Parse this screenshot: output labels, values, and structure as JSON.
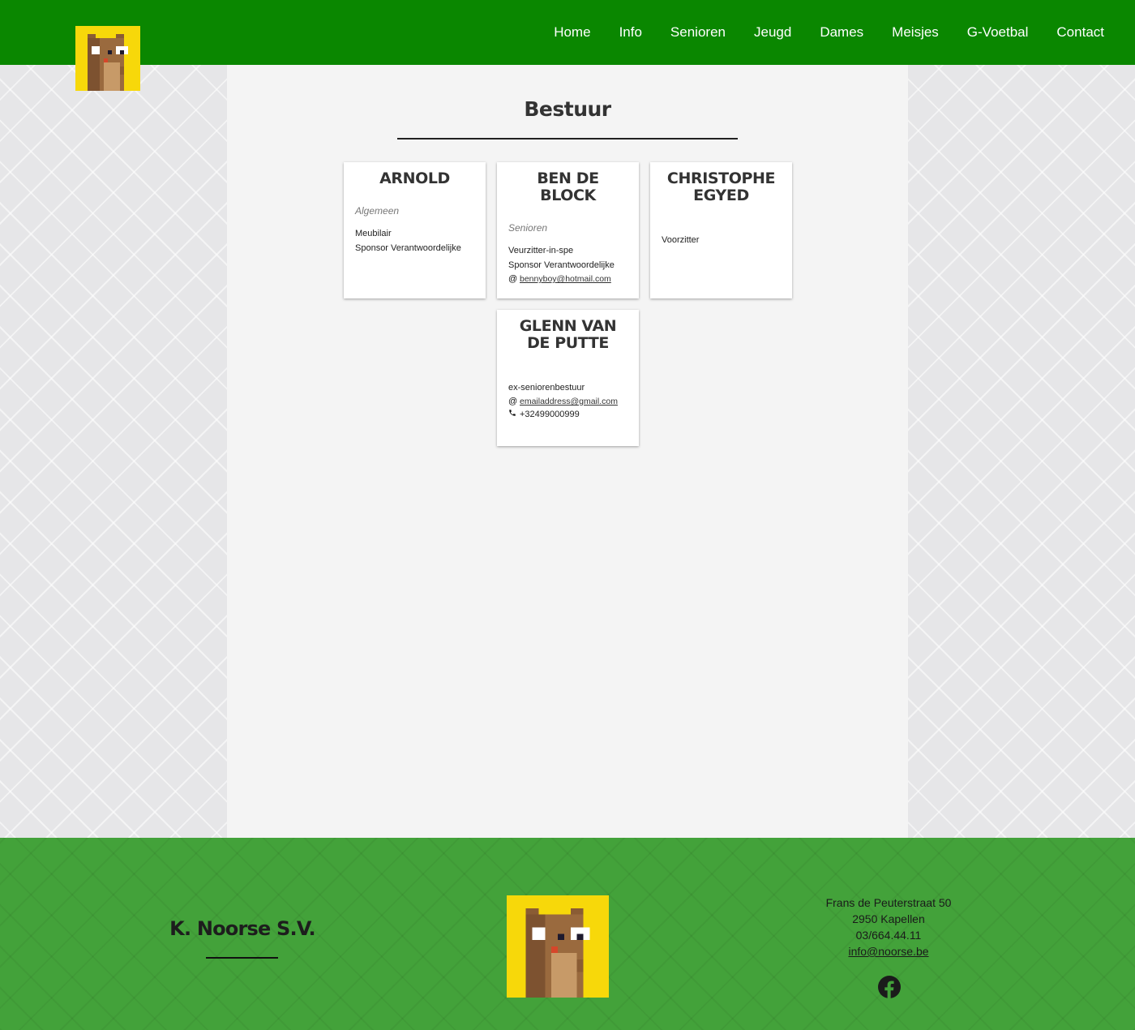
{
  "nav": {
    "items": [
      {
        "label": "Home",
        "name": "nav-home"
      },
      {
        "label": "Info",
        "name": "nav-info"
      },
      {
        "label": "Senioren",
        "name": "nav-senioren"
      },
      {
        "label": "Jeugd",
        "name": "nav-jeugd"
      },
      {
        "label": "Dames",
        "name": "nav-dames"
      },
      {
        "label": "Meisjes",
        "name": "nav-meisjes"
      },
      {
        "label": "G-Voetbal",
        "name": "nav-g-voetbal"
      },
      {
        "label": "Contact",
        "name": "nav-contact"
      }
    ]
  },
  "page": {
    "title": "Bestuur"
  },
  "members": [
    {
      "name": "Arnold",
      "group": "Algemeen",
      "roles": [
        "Meubilair",
        "Sponsor Verantwoordelijke"
      ],
      "email": "",
      "phone": ""
    },
    {
      "name": "Ben De Block",
      "group": "Senioren",
      "roles": [
        "Veurzitter-in-spe",
        "Sponsor Verantwoordelijke"
      ],
      "email": "bennyboy@hotmail.com",
      "phone": ""
    },
    {
      "name": "Christophe Egyed",
      "group": "",
      "roles": [
        "Voorzitter"
      ],
      "email": "",
      "phone": ""
    },
    {
      "name": "Glenn Van De Putte",
      "group": "",
      "roles": [
        "ex-seniorenbestuur"
      ],
      "email": "emailaddress@gmail.com",
      "phone": "+32499000999"
    }
  ],
  "footer": {
    "club_name": "K. Noorse S.V.",
    "address_line1": "Frans de Peuterstraat 50",
    "address_line2": "2950 Kapellen",
    "phone": "03/664.44.11",
    "email": "info@noorse.be",
    "social_icon": "facebook-icon"
  },
  "colors": {
    "header_green": "#0a8700",
    "footer_green": "#43a23a",
    "logo_yellow": "#f7d80a"
  }
}
